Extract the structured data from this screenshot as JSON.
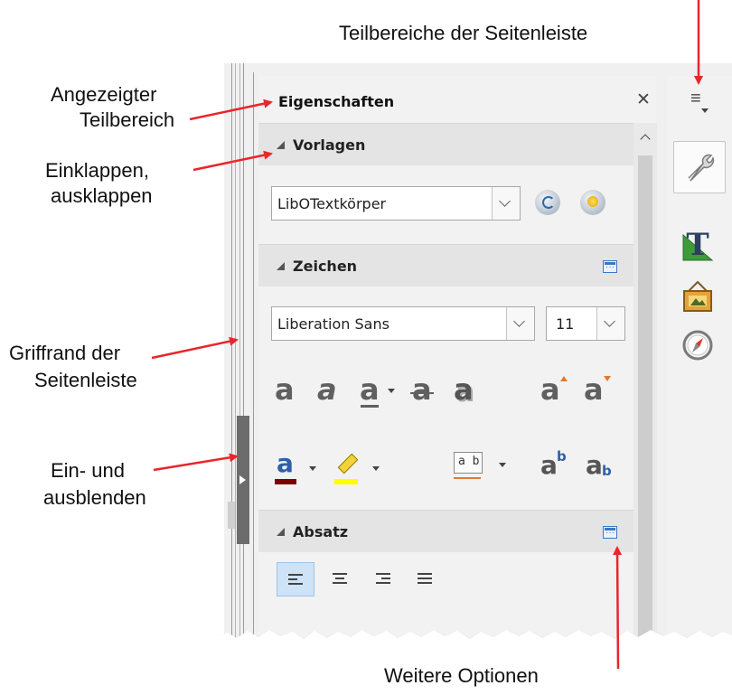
{
  "annotations": {
    "sidebar_tabs": "Teilbereiche der Seitenleiste",
    "shown_panel_l1": "Angezeigter",
    "shown_panel_l2": "Teilbereich",
    "collapse_l1": "Einklappen,",
    "collapse_l2": "ausklappen",
    "grip_l1": "Griffrand der",
    "grip_l2": "Seitenleiste",
    "toggle_l1": "Ein- und",
    "toggle_l2": "ausblenden",
    "more_options": "Weitere Optionen"
  },
  "deck": {
    "title": "Eigenschaften",
    "close_glyph": "✕",
    "menu_glyph": "≡"
  },
  "panels": {
    "styles": {
      "title": "Vorlagen",
      "style_value": "LibOTextkörper"
    },
    "character": {
      "title": "Zeichen",
      "font_name": "Liberation Sans",
      "font_size": "11"
    },
    "paragraph": {
      "title": "Absatz"
    }
  },
  "format_glyphs": {
    "bold": "a",
    "italic": "a",
    "underline": "a",
    "strike": "a",
    "shadow": "a",
    "grow": "a",
    "shrink": "a",
    "font_color": "a",
    "spacing": "a b",
    "superscript": "a",
    "superscript_mark": "b",
    "subscript": "a",
    "subscript_mark": "b"
  },
  "tabbar": {
    "icons": [
      "properties-icon",
      "styles-icon",
      "gallery-icon",
      "navigator-icon"
    ],
    "styles_glyph": "T"
  },
  "colors": {
    "annotation_arrow": "#e8262b",
    "accent": "#3b78c4",
    "font_color_bar": "#7b0000",
    "highlight_bar": "#ffff00"
  }
}
